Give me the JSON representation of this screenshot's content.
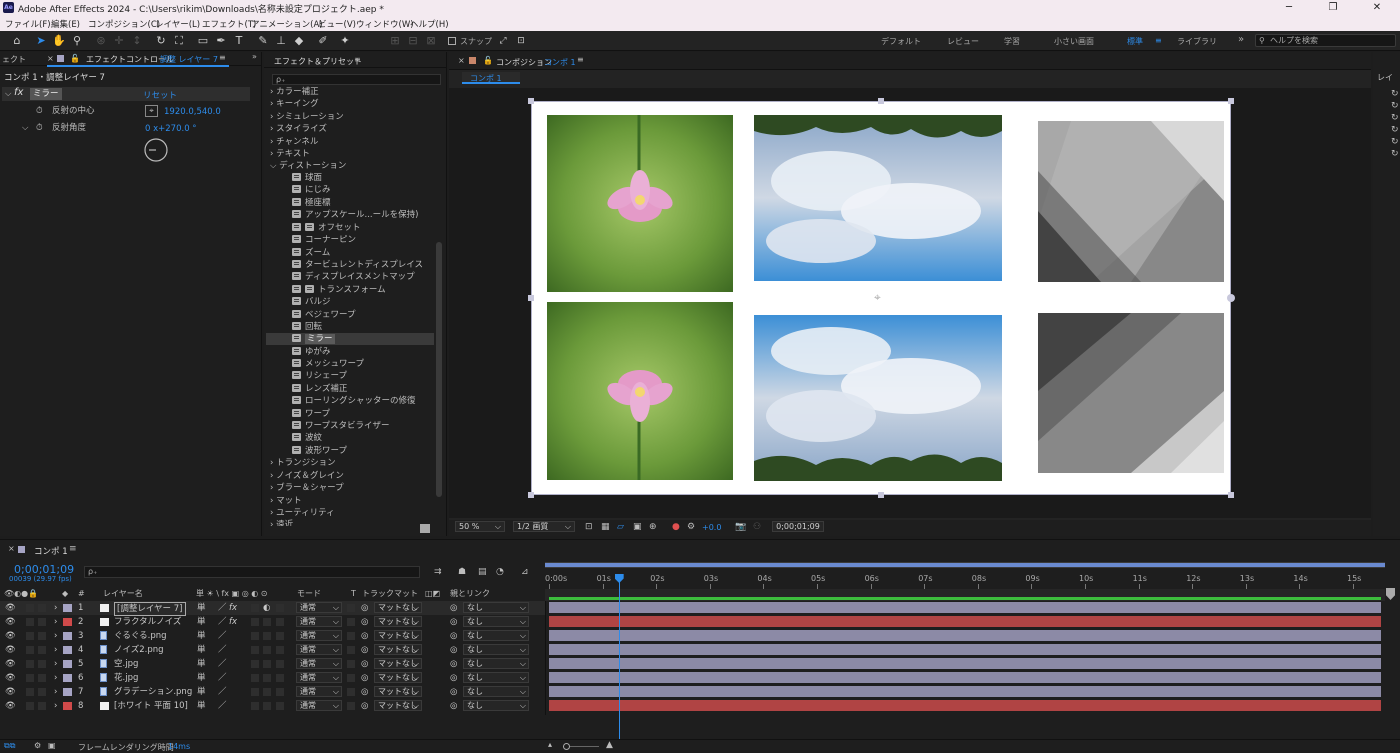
{
  "window": {
    "app_icon": "Ae",
    "title": "Adobe After Effects 2024 - C:\\Users\\rikim\\Downloads\\名称未設定プロジェクト.aep *",
    "minimize": "─",
    "maximize": "❐",
    "close": "✕"
  },
  "menu": [
    "ファイル(F)",
    "編集(E)",
    "コンポジション(C)",
    "レイヤー(L)",
    "エフェクト(T)",
    "アニメーション(A)",
    "ビュー(V)",
    "ウィンドウ(W)",
    "ヘルプ(H)"
  ],
  "toolbar": {
    "snap_label": "スナップ",
    "workspaces": [
      "デフォルト",
      "レビュー",
      "学習",
      "小さい画面",
      "標準",
      "ライブラリ"
    ],
    "current_workspace": "標準",
    "overflow": "»",
    "help_placeholder": "ヘルプを検索"
  },
  "effect_controls": {
    "left_tab_fragment": "ェクト",
    "tab_label": "エフェクトコントロール",
    "tab_layer": "調整 レイヤー 7",
    "breadcrumb": "コンポ 1・調整レイヤー 7",
    "effect_name": "ミラー",
    "reset_label": "リセット",
    "fx_label": "fx",
    "params": [
      {
        "name": "反射の中心",
        "value": "1920.0,540.0"
      },
      {
        "name": "反射角度",
        "value": "0 x+270.0 °"
      }
    ]
  },
  "effects_presets": {
    "title": "エフェクト＆プリセット",
    "search_placeholder": "ρ₊",
    "categories_top": [
      "カラー補正",
      "キーイング",
      "シミュレーション",
      "スタイライズ",
      "チャンネル",
      "テキスト",
      "ディストーション"
    ],
    "distortion_items": [
      "球面",
      "にじみ",
      "極座標",
      "アップスケール...ールを保持)",
      "オフセット",
      "コーナーピン",
      "ズーム",
      "タービュレントディスプレイス",
      "ディスプレイスメントマップ",
      "トランスフォーム",
      "バルジ",
      "ベジェワープ",
      "回転",
      "ミラー",
      "ゆがみ",
      "メッシュワープ",
      "リシェープ",
      "レンズ補正",
      "ローリングシャッターの修復",
      "ワープ",
      "ワープスタビライザー",
      "波紋",
      "波形ワープ"
    ],
    "selected_item": "ミラー",
    "categories_bottom": [
      "トランジション",
      "ノイズ＆グレイン",
      "ブラー＆シャープ",
      "マット",
      "ユーティリティ",
      "遠近"
    ]
  },
  "composition": {
    "tab_label": "コンポジション",
    "tab_name": "コンポ 1",
    "flow_tab": "コンポ 1",
    "zoom": "50 %",
    "resolution": "1/2 画質",
    "exposure": "+0.0",
    "timecode": "0;00;01;09"
  },
  "timeline": {
    "tab_name": "コンポ 1",
    "timecode": "0;00;01;09",
    "fps": "00039 (29.97 fps)",
    "search_placeholder": "ρ₊",
    "headers": {
      "num": "#",
      "layer_name": "レイヤー名",
      "switches": "単 ☀ \\ fx ▣ ◎ ◐ ⊙",
      "mode": "モード",
      "t": "T",
      "track_matte": "トラックマット",
      "parent": "親とリンク"
    },
    "ruler": [
      "0:00s",
      "01s",
      "02s",
      "03s",
      "04s",
      "05s",
      "06s",
      "07s",
      "08s",
      "09s",
      "10s",
      "11s",
      "12s",
      "13s",
      "14s",
      "15s"
    ],
    "playhead_seconds": 1.3,
    "layers": [
      {
        "num": "1",
        "name": "[調整レイヤー 7]",
        "color": "#a6a4c4",
        "mode": "通常",
        "matte": "マットなし",
        "parent": "なし",
        "type": "solid",
        "fx": true,
        "bar": "#8c8aa6"
      },
      {
        "num": "2",
        "name": "フラクタルノイズ",
        "color": "#d04a4a",
        "mode": "通常",
        "matte": "マットなし",
        "parent": "なし",
        "type": "solid",
        "fx": true,
        "bar": "#b04444"
      },
      {
        "num": "3",
        "name": "ぐるぐる.png",
        "color": "#a6a4c4",
        "mode": "通常",
        "matte": "マットなし",
        "parent": "なし",
        "type": "file",
        "fx": false,
        "bar": "#8c8aa6"
      },
      {
        "num": "4",
        "name": "ノイズ2.png",
        "color": "#a6a4c4",
        "mode": "通常",
        "matte": "マットなし",
        "parent": "なし",
        "type": "file",
        "fx": false,
        "bar": "#8c8aa6"
      },
      {
        "num": "5",
        "name": "空.jpg",
        "color": "#a6a4c4",
        "mode": "通常",
        "matte": "マットなし",
        "parent": "なし",
        "type": "file",
        "fx": false,
        "bar": "#8c8aa6"
      },
      {
        "num": "6",
        "name": "花.jpg",
        "color": "#a6a4c4",
        "mode": "通常",
        "matte": "マットなし",
        "parent": "なし",
        "type": "file",
        "fx": false,
        "bar": "#8c8aa6"
      },
      {
        "num": "7",
        "name": "グラデーション.png",
        "color": "#a6a4c4",
        "mode": "通常",
        "matte": "マットなし",
        "parent": "なし",
        "type": "file",
        "fx": false,
        "bar": "#8c8aa6"
      },
      {
        "num": "8",
        "name": "[ホワイト 平面 10]",
        "color": "#d04a4a",
        "mode": "通常",
        "matte": "マットなし",
        "parent": "なし",
        "type": "solid",
        "fx": false,
        "bar": "#b04444"
      }
    ],
    "footer_label": "フレームレンダリング時間",
    "footer_value": "14ms"
  }
}
